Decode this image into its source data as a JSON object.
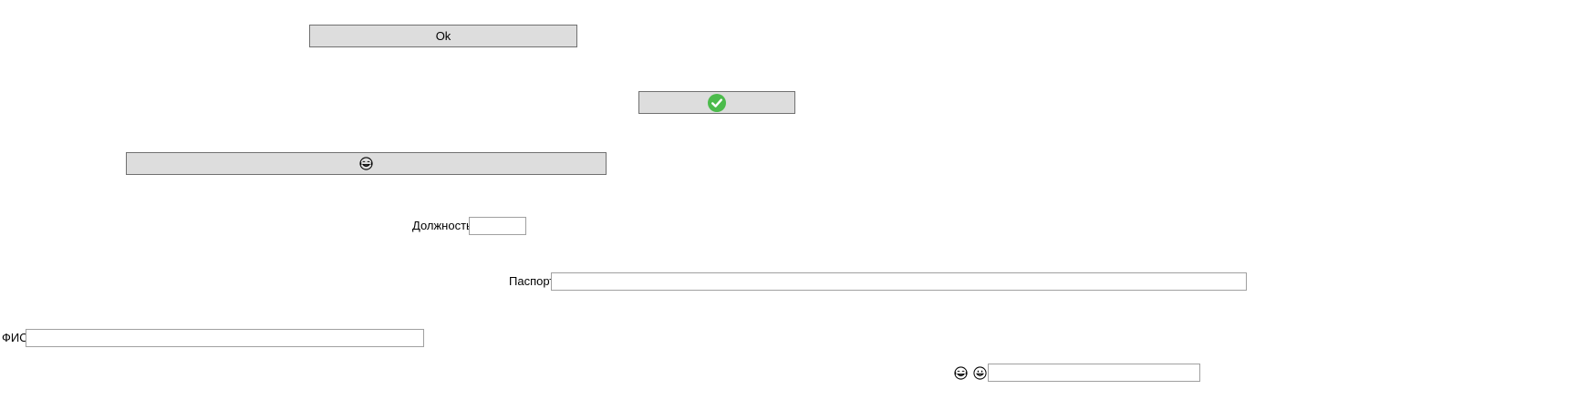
{
  "ok_button": {
    "label": "Ok"
  },
  "check_button": {
    "icon": "green-checkmark-icon",
    "color": "#4cbb4c"
  },
  "emoji_button": {
    "icon": "grinning-face-with-tears-icon"
  },
  "position_field": {
    "label": "Должность",
    "value": ""
  },
  "passport_field": {
    "label": "Паспорт",
    "value": ""
  },
  "fio_field": {
    "label": "ФИО",
    "value": ""
  },
  "emoji_field": {
    "icons": [
      "grinning-face-with-tears-icon",
      "grinning-face-icon"
    ],
    "value": ""
  }
}
